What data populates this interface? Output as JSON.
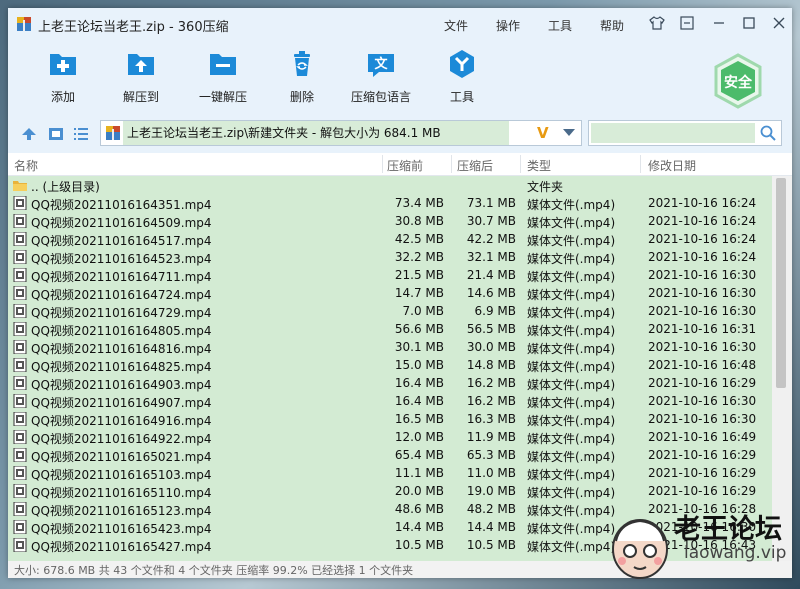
{
  "window": {
    "title": "上老王论坛当老王.zip - 360压缩",
    "menus": [
      "文件",
      "操作",
      "工具",
      "帮助"
    ]
  },
  "toolbar": {
    "buttons": [
      {
        "label": "添加",
        "icon": "add-icon"
      },
      {
        "label": "解压到",
        "icon": "extract-to-icon"
      },
      {
        "label": "一键解压",
        "icon": "one-click-extract-icon"
      },
      {
        "label": "删除",
        "icon": "trash-icon"
      },
      {
        "label": "压缩包语言",
        "icon": "language-icon"
      },
      {
        "label": "工具",
        "icon": "tools-icon"
      }
    ],
    "security_label": "安全"
  },
  "address": {
    "path": "上老王论坛当老王.zip\\新建文件夹 - 解包大小为 684.1 MB",
    "search_placeholder": ""
  },
  "columns": [
    "名称",
    "压缩前",
    "压缩后",
    "类型",
    "修改日期"
  ],
  "files": [
    {
      "name": ".. (上级目录)",
      "size": "",
      "packed": "",
      "type": "文件夹",
      "date": "",
      "icon": "folder-icon"
    },
    {
      "name": "QQ视频20211016164351.mp4",
      "size": "73.4 MB",
      "packed": "73.1 MB",
      "type": "媒体文件(.mp4)",
      "date": "2021-10-16 16:24",
      "icon": "video-file-icon"
    },
    {
      "name": "QQ视频20211016164509.mp4",
      "size": "30.8 MB",
      "packed": "30.7 MB",
      "type": "媒体文件(.mp4)",
      "date": "2021-10-16 16:24",
      "icon": "video-file-icon"
    },
    {
      "name": "QQ视频20211016164517.mp4",
      "size": "42.5 MB",
      "packed": "42.2 MB",
      "type": "媒体文件(.mp4)",
      "date": "2021-10-16 16:24",
      "icon": "video-file-icon"
    },
    {
      "name": "QQ视频20211016164523.mp4",
      "size": "32.2 MB",
      "packed": "32.1 MB",
      "type": "媒体文件(.mp4)",
      "date": "2021-10-16 16:24",
      "icon": "video-file-icon"
    },
    {
      "name": "QQ视频20211016164711.mp4",
      "size": "21.5 MB",
      "packed": "21.4 MB",
      "type": "媒体文件(.mp4)",
      "date": "2021-10-16 16:30",
      "icon": "video-file-icon"
    },
    {
      "name": "QQ视频20211016164724.mp4",
      "size": "14.7 MB",
      "packed": "14.6 MB",
      "type": "媒体文件(.mp4)",
      "date": "2021-10-16 16:30",
      "icon": "video-file-icon"
    },
    {
      "name": "QQ视频20211016164729.mp4",
      "size": "7.0 MB",
      "packed": "6.9 MB",
      "type": "媒体文件(.mp4)",
      "date": "2021-10-16 16:30",
      "icon": "video-file-icon"
    },
    {
      "name": "QQ视频20211016164805.mp4",
      "size": "56.6 MB",
      "packed": "56.5 MB",
      "type": "媒体文件(.mp4)",
      "date": "2021-10-16 16:31",
      "icon": "video-file-icon"
    },
    {
      "name": "QQ视频20211016164816.mp4",
      "size": "30.1 MB",
      "packed": "30.0 MB",
      "type": "媒体文件(.mp4)",
      "date": "2021-10-16 16:30",
      "icon": "video-file-icon"
    },
    {
      "name": "QQ视频20211016164825.mp4",
      "size": "15.0 MB",
      "packed": "14.8 MB",
      "type": "媒体文件(.mp4)",
      "date": "2021-10-16 16:48",
      "icon": "video-file-icon"
    },
    {
      "name": "QQ视频20211016164903.mp4",
      "size": "16.4 MB",
      "packed": "16.2 MB",
      "type": "媒体文件(.mp4)",
      "date": "2021-10-16 16:29",
      "icon": "video-file-icon"
    },
    {
      "name": "QQ视频20211016164907.mp4",
      "size": "16.4 MB",
      "packed": "16.2 MB",
      "type": "媒体文件(.mp4)",
      "date": "2021-10-16 16:30",
      "icon": "video-file-icon"
    },
    {
      "name": "QQ视频20211016164916.mp4",
      "size": "16.5 MB",
      "packed": "16.3 MB",
      "type": "媒体文件(.mp4)",
      "date": "2021-10-16 16:30",
      "icon": "video-file-icon"
    },
    {
      "name": "QQ视频20211016164922.mp4",
      "size": "12.0 MB",
      "packed": "11.9 MB",
      "type": "媒体文件(.mp4)",
      "date": "2021-10-16 16:49",
      "icon": "video-file-icon"
    },
    {
      "name": "QQ视频20211016165021.mp4",
      "size": "65.4 MB",
      "packed": "65.3 MB",
      "type": "媒体文件(.mp4)",
      "date": "2021-10-16 16:29",
      "icon": "video-file-icon"
    },
    {
      "name": "QQ视频20211016165103.mp4",
      "size": "11.1 MB",
      "packed": "11.0 MB",
      "type": "媒体文件(.mp4)",
      "date": "2021-10-16 16:29",
      "icon": "video-file-icon"
    },
    {
      "name": "QQ视频20211016165110.mp4",
      "size": "20.0 MB",
      "packed": "19.0 MB",
      "type": "媒体文件(.mp4)",
      "date": "2021-10-16 16:29",
      "icon": "video-file-icon"
    },
    {
      "name": "QQ视频20211016165123.mp4",
      "size": "48.6 MB",
      "packed": "48.2 MB",
      "type": "媒体文件(.mp4)",
      "date": "2021-10-16 16:28",
      "icon": "video-file-icon"
    },
    {
      "name": "QQ视频20211016165423.mp4",
      "size": "14.4 MB",
      "packed": "14.4 MB",
      "type": "媒体文件(.mp4)",
      "date": "2021-10-16 16:30",
      "icon": "video-file-icon"
    },
    {
      "name": "QQ视频20211016165427.mp4",
      "size": "10.5 MB",
      "packed": "10.5 MB",
      "type": "媒体文件(.mp4)",
      "date": "2021-10-16 16:43",
      "icon": "video-file-icon"
    }
  ],
  "status": "大小: 678.6 MB 共 43 个文件和 4 个文件夹 压缩率 99.2% 已经选择 1 个文件夹",
  "watermark": {
    "text": "老王论坛",
    "sub": "laowang.vip"
  },
  "colors": {
    "accent": "#1c8ad8",
    "selection": "#d3ebd3",
    "toolbar_bg": "#e8f2fb",
    "security": "#4cbb6b"
  }
}
